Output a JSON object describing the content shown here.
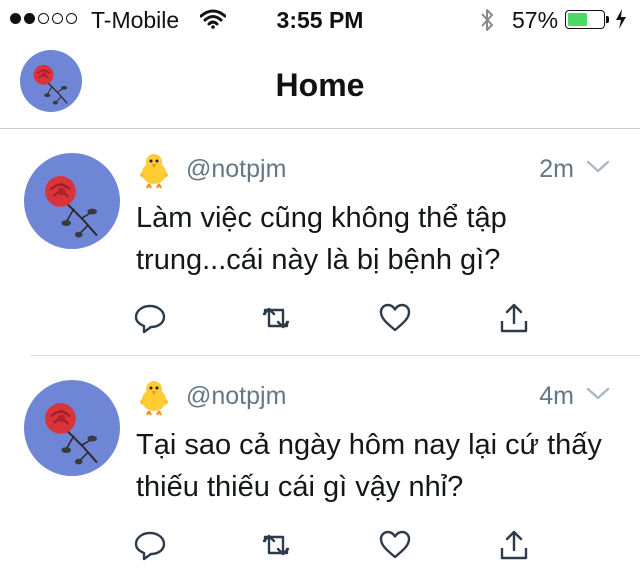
{
  "status_bar": {
    "carrier": "T-Mobile",
    "time": "3:55 PM",
    "battery": "57%",
    "battery_level": 0.57,
    "signal_full": 2,
    "signal_total": 5
  },
  "nav": {
    "title": "Home"
  },
  "tweets": [
    {
      "emoji": "hatching-chick",
      "handle": "@notpjm",
      "time": "2m",
      "text": "Làm việc cũng không thể tập trung...cái này là bị bệnh gì?"
    },
    {
      "emoji": "hatching-chick",
      "handle": "@notpjm",
      "time": "4m",
      "text": "Tại sao cả ngày hôm nay lại cứ thấy thiếu thiếu cái gì vậy nhỉ?"
    }
  ],
  "colors": {
    "accent_battery": "#4cd964",
    "secondary_text": "#657786",
    "avatar_bg": "#6f86d6"
  }
}
